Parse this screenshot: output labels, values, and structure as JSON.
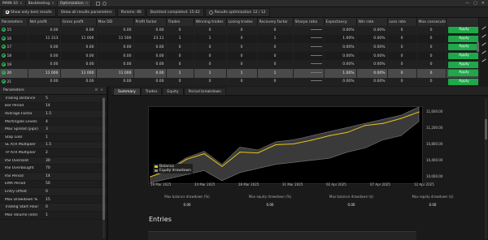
{
  "window": {
    "tabs": [
      {
        "label": "MAIN 10",
        "active": false
      },
      {
        "label": "Backtesting",
        "active": false
      },
      {
        "label": "Optimization",
        "active": true
      }
    ],
    "controls": [
      "—",
      "▢",
      "✕"
    ]
  },
  "toolbar": {
    "items": [
      "Show only best results",
      "Show all results parameters",
      "Params: 66",
      "Backtest completed: 15:42",
      "Results optimization 12 / 12"
    ]
  },
  "table": {
    "columns": [
      "Parameters",
      "Net profit",
      "Gross profit",
      "Max DD",
      "Profit factor",
      "Trades",
      "Winning trades",
      "Losing trades",
      "Recovery factor",
      "Sharpe ratio",
      "Expectancy",
      "Win rate",
      "Loss rate",
      "Max consecutive",
      ""
    ],
    "rows": [
      {
        "id": "15",
        "c1": "0.00",
        "c2": "0.00",
        "c3": "0.00",
        "c4": "0.00",
        "c5": "0",
        "c6": "0",
        "c7": "0",
        "c8": "0",
        "c9": "0.00%",
        "c10": "0.00%",
        "c11": "0",
        "c12": "0",
        "apply": "Apply",
        "selected": false
      },
      {
        "id": "16",
        "c1": "11 313",
        "c2": "11 000",
        "c3": "11 500",
        "c4": "23.11",
        "c5": "1",
        "c6": "1",
        "c7": "0",
        "c8": "1",
        "c9": "1.00%",
        "c10": "0.00%",
        "c11": "0",
        "c12": "0",
        "apply": "Apply",
        "selected": false
      },
      {
        "id": "17",
        "c1": "0.00",
        "c2": "0.00",
        "c3": "0.00",
        "c4": "0.00",
        "c5": "0",
        "c6": "0",
        "c7": "0",
        "c8": "0",
        "c9": "0.00%",
        "c10": "0.00%",
        "c11": "0",
        "c12": "0",
        "apply": "Apply",
        "selected": false
      },
      {
        "id": "18",
        "c1": "0.00",
        "c2": "0.00",
        "c3": "0.00",
        "c4": "0.00",
        "c5": "0",
        "c6": "0",
        "c7": "0",
        "c8": "0",
        "c9": "0.00%",
        "c10": "0.00%",
        "c11": "0",
        "c12": "0",
        "apply": "Apply",
        "selected": false
      },
      {
        "id": "19",
        "c1": "0.00",
        "c2": "0.00",
        "c3": "0.00",
        "c4": "0.00",
        "c5": "0",
        "c6": "0",
        "c7": "0",
        "c8": "0",
        "c9": "0.00%",
        "c10": "0.00%",
        "c11": "0",
        "c12": "0",
        "apply": "Apply",
        "selected": false
      },
      {
        "id": "20",
        "c1": "11 000",
        "c2": "11 000",
        "c3": "11 000",
        "c4": "0.00",
        "c5": "1",
        "c6": "1",
        "c7": "1",
        "c8": "1",
        "c9": "1.00%",
        "c10": "0.00%",
        "c11": "0",
        "c12": "0",
        "apply": "Apply",
        "selected": true
      },
      {
        "id": "21",
        "c1": "0.00",
        "c2": "0.00",
        "c3": "0.00",
        "c4": "0.00",
        "c5": "0",
        "c6": "0",
        "c7": "0",
        "c8": "0",
        "c9": "0.00%",
        "c10": "0.00%",
        "c11": "0",
        "c12": "0",
        "apply": "Apply",
        "selected": false
      }
    ]
  },
  "params": {
    "title": "Parameters",
    "items": [
      {
        "name": "Trailing Distance",
        "value": "5"
      },
      {
        "name": "Bar Period",
        "value": "14"
      },
      {
        "name": "Average Factor",
        "value": "1.5"
      },
      {
        "name": "Martingale Levels",
        "value": "4"
      },
      {
        "name": "Max Spread (pips)",
        "value": "3"
      },
      {
        "name": "Stop Loss",
        "value": "1"
      },
      {
        "name": "SL ATR Multiplier",
        "value": "1.5"
      },
      {
        "name": "TP ATR Multiplier",
        "value": "2"
      },
      {
        "name": "RSI Oversold",
        "value": "30"
      },
      {
        "name": "RSI Overbought",
        "value": "70"
      },
      {
        "name": "RSI Period",
        "value": "14"
      },
      {
        "name": "EMA Period",
        "value": "50"
      },
      {
        "name": "Entry Offset",
        "value": "0"
      },
      {
        "name": "Max Drawdown %",
        "value": "15"
      },
      {
        "name": "Trading Start Hour",
        "value": "0"
      },
      {
        "name": "Max Volume (lots)",
        "value": "1"
      }
    ]
  },
  "report": {
    "tabs": [
      {
        "label": "Summary",
        "active": true
      },
      {
        "label": "Trades",
        "active": false
      },
      {
        "label": "Equity",
        "active": false
      },
      {
        "label": "Period breakdown",
        "active": false
      }
    ],
    "entries_title": "Entries",
    "stats": [
      {
        "label": "Max balance drawdown (%)",
        "value": "0.00"
      },
      {
        "label": "Max equity drawdown (%)",
        "value": "0.00"
      },
      {
        "label": "Max balance drawdown ($)",
        "value": "0.00"
      },
      {
        "label": "Max equity drawdown ($)",
        "value": "0.00"
      }
    ]
  },
  "chart_data": {
    "type": "line",
    "x": [
      "19 Mar 2025",
      "24 Mar 2025",
      "28 Mar 2025",
      "31 Mar 2025",
      "02 Apr 2025",
      "07 Apr 2025",
      "12 Apr 2025"
    ],
    "series": [
      {
        "name": "Balance",
        "color": "#e6c21a",
        "values": [
          10000,
          10150,
          10420,
          10560,
          10250,
          10600,
          10580,
          10780,
          10800,
          10890,
          11000,
          11080,
          11250,
          11300,
          11420,
          11580
        ]
      },
      {
        "name": "Equity drawdown",
        "color": "#3a3a3a",
        "upper": [
          10000,
          10180,
          10460,
          10620,
          10300,
          10720,
          10650,
          10850,
          10900,
          11000,
          11100,
          11200,
          11300,
          11400,
          11500,
          11700
        ],
        "lower": [
          9850,
          9950,
          10050,
          10150,
          9900,
          10100,
          10200,
          10300,
          10350,
          10400,
          10450,
          10600,
          10700,
          10900,
          11000,
          11350
        ]
      }
    ],
    "y_ticks": [
      "11,600.00",
      "11,200.00",
      "10,800.00",
      "10,400.00",
      "10,000.00"
    ],
    "ylim": [
      9800,
      11700
    ],
    "grid": false,
    "legend_position": "bottom-left"
  }
}
